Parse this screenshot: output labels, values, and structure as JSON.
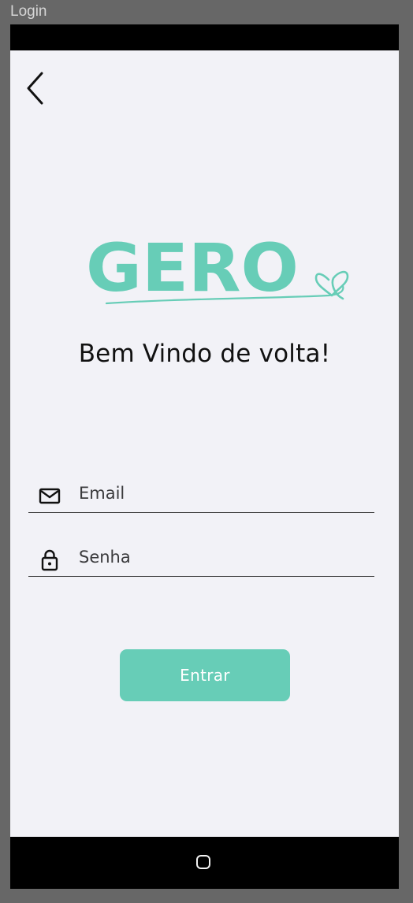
{
  "window": {
    "title": "Login"
  },
  "header": {
    "back_icon": "chevron-left-icon"
  },
  "logo": {
    "text": "GERO",
    "color": "#67cdb7",
    "accent_icon": "heart-icon"
  },
  "welcome": {
    "text": "Bem Vindo de volta!"
  },
  "form": {
    "email": {
      "placeholder": "Email",
      "value": "",
      "icon": "mail-icon"
    },
    "password": {
      "placeholder": "Senha",
      "value": "",
      "icon": "lock-icon"
    },
    "submit_label": "Entrar",
    "submit_color": "#67cdb7"
  },
  "navigation": {
    "home_icon": "home-square-icon"
  }
}
